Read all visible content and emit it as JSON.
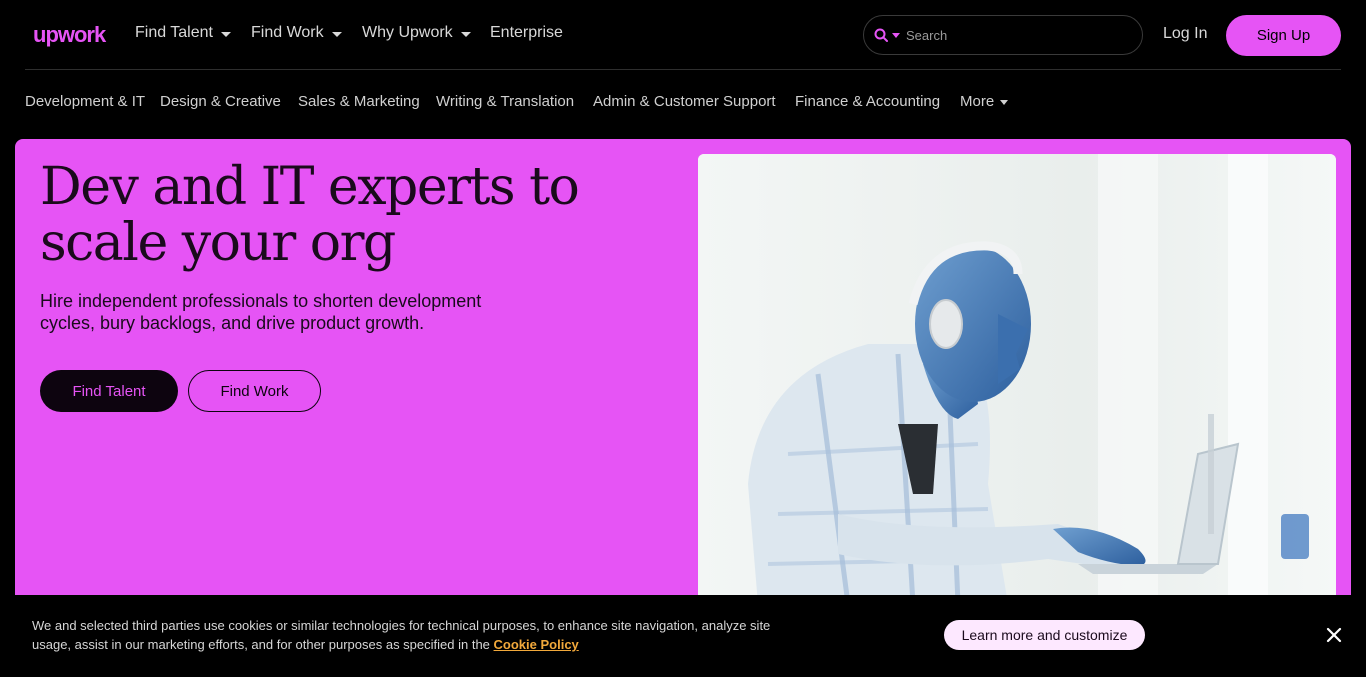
{
  "brand": {
    "logo_text": "upwork",
    "accent": "#e654f5"
  },
  "topnav": {
    "items": [
      {
        "label": "Find Talent",
        "has_dropdown": true
      },
      {
        "label": "Find Work",
        "has_dropdown": true
      },
      {
        "label": "Why Upwork",
        "has_dropdown": true
      },
      {
        "label": "Enterprise",
        "has_dropdown": false
      }
    ],
    "search": {
      "placeholder": "Search",
      "icon": "search-icon"
    },
    "login_label": "Log In",
    "signup_label": "Sign Up"
  },
  "categories": {
    "items": [
      "Development & IT",
      "Design & Creative",
      "Sales & Marketing",
      "Writing & Translation",
      "Admin & Customer Support",
      "Finance & Accounting"
    ],
    "more_label": "More"
  },
  "hero": {
    "title": "Dev and IT experts to scale your org",
    "subtitle": "Hire independent professionals to shorten development cycles, bury backlogs, and drive product growth.",
    "primary_button": "Find Talent",
    "secondary_button": "Find Work",
    "background": "#e654f5"
  },
  "cookie_banner": {
    "text": "We and selected third parties use cookies or similar technologies for technical purposes, to enhance site navigation, analyze site usage, assist in our marketing efforts, and for other purposes as specified in the",
    "link_label": "Cookie Policy",
    "button_label": "Learn more and customize",
    "close_icon": "close-icon"
  }
}
